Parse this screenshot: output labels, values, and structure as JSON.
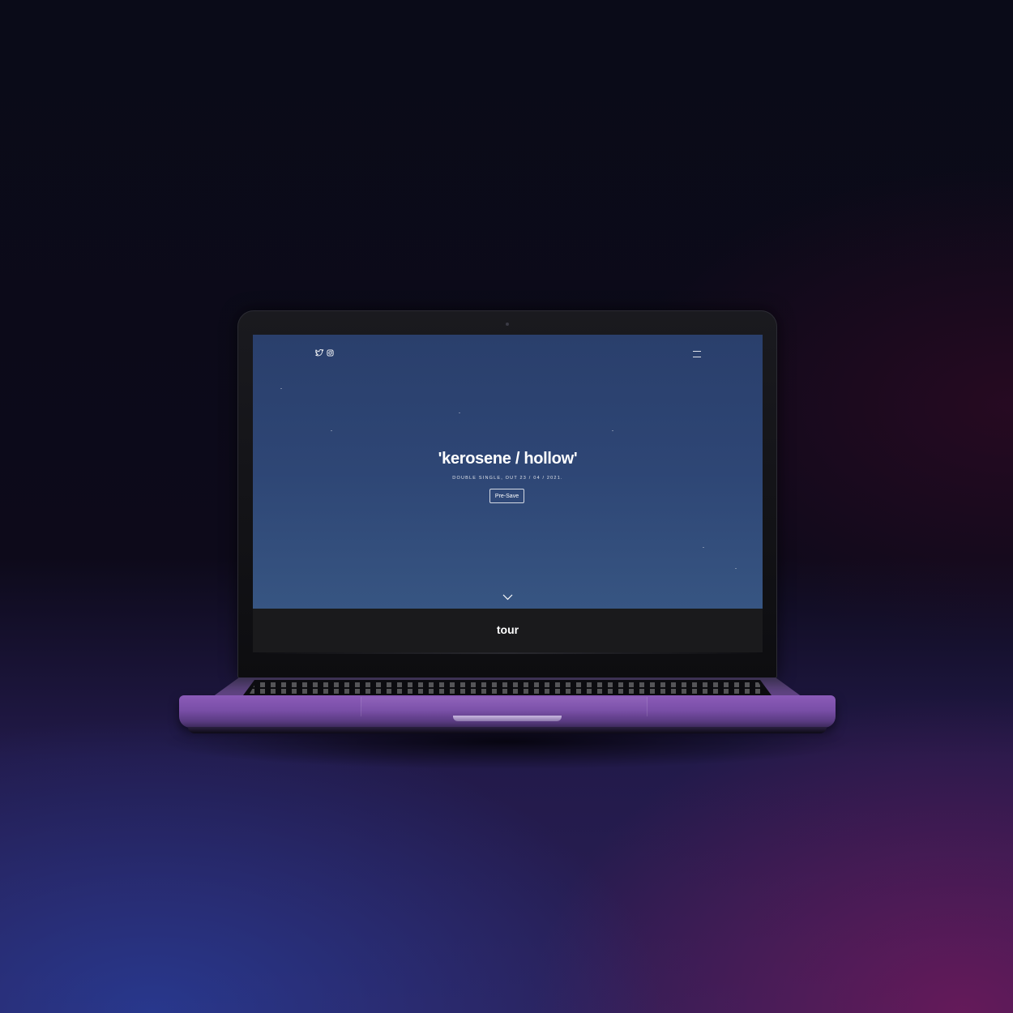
{
  "site": {
    "header": {
      "social_icons": [
        "twitter-icon",
        "instagram-icon"
      ],
      "menu_icon": "hamburger-menu-icon"
    },
    "hero": {
      "title": "'kerosene / hollow'",
      "subtitle": "DOUBLE SINGLE, OUT 23 / 04 / 2021.",
      "cta_label": "Pre-Save",
      "scroll_icon": "chevron-down-icon"
    },
    "section": {
      "label": "tour"
    }
  },
  "colors": {
    "hero_top": "#2a3f6c",
    "hero_bottom": "#375582",
    "section_bg": "#1a1a1c",
    "text": "#ffffff",
    "laptop_body": "#7a4fa8"
  }
}
